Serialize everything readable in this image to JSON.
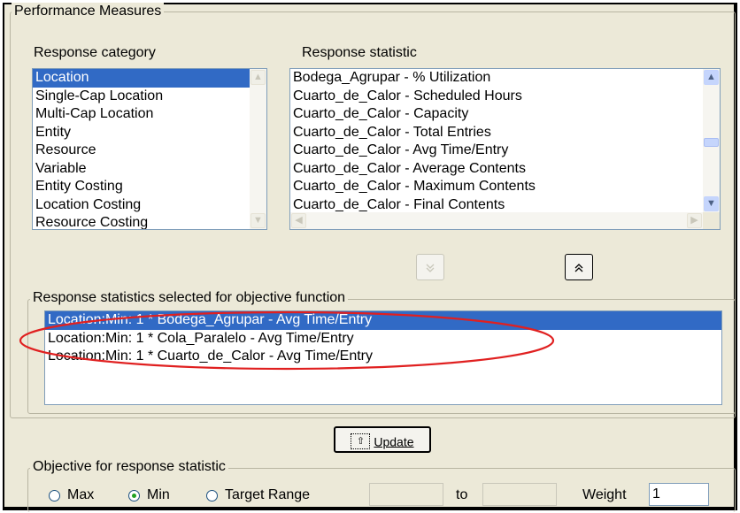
{
  "panel": {
    "title": "Performance Measures"
  },
  "response_category": {
    "label": "Response category",
    "items": [
      "Location",
      "Single-Cap Location",
      "Multi-Cap Location",
      "Entity",
      "Resource",
      "Variable",
      "Entity Costing",
      "Location Costing",
      "Resource Costing"
    ],
    "selected": "Location"
  },
  "response_statistic": {
    "label": "Response statistic",
    "items": [
      "Bodega_Agrupar - % Utilization",
      "Cuarto_de_Calor - Scheduled Hours",
      "Cuarto_de_Calor - Capacity",
      "Cuarto_de_Calor - Total Entries",
      "Cuarto_de_Calor - Avg Time/Entry",
      "Cuarto_de_Calor - Average Contents",
      "Cuarto_de_Calor - Maximum Contents",
      "Cuarto_de_Calor - Final Contents"
    ]
  },
  "move_buttons": {
    "down_icon": "double-chevron-down",
    "up_icon": "double-chevron-up"
  },
  "selected_statistics": {
    "label": "Response statistics selected for objective function",
    "items": [
      "Location:Min: 1 * Bodega_Agrupar - Avg Time/Entry",
      "Location:Min: 1 * Cola_Paralelo - Avg Time/Entry",
      "Location:Min: 1 * Cuarto_de_Calor - Avg Time/Entry"
    ],
    "highlight_color": "#e02020"
  },
  "update_button": {
    "label": "Update"
  },
  "objective": {
    "label": "Objective for response statistic",
    "options": {
      "max": "Max",
      "min": "Min",
      "target": "Target Range"
    },
    "selected": "Min",
    "to_label": "to",
    "range_from": "",
    "range_to": "",
    "weight_label": "Weight",
    "weight_value": "1"
  }
}
